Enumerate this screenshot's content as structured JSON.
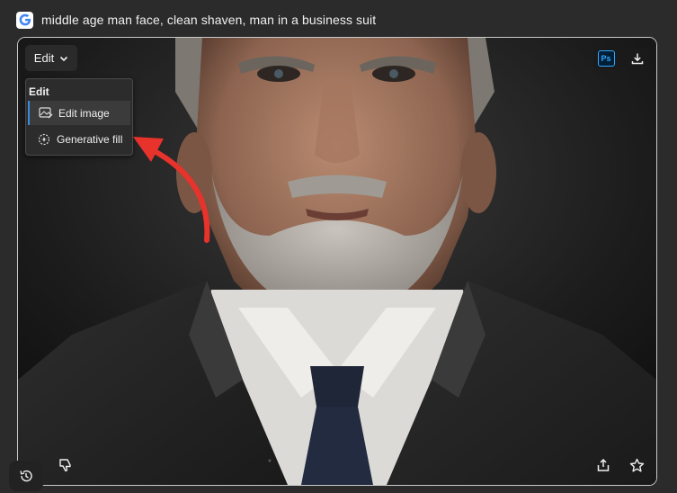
{
  "prompt": {
    "text": "middle age man face, clean shaven, man in a business suit"
  },
  "toolbar": {
    "edit_label": "Edit",
    "ps_label": "Ps"
  },
  "edit_menu": {
    "header": "Edit",
    "items": [
      {
        "label": "Edit image",
        "icon": "image-edit-icon"
      },
      {
        "label": "Generative fill",
        "icon": "generative-fill-icon"
      }
    ]
  },
  "colors": {
    "accent": "#3d8bdb",
    "annotation_arrow": "#e8322c",
    "ps_blue": "#31a8ff"
  }
}
